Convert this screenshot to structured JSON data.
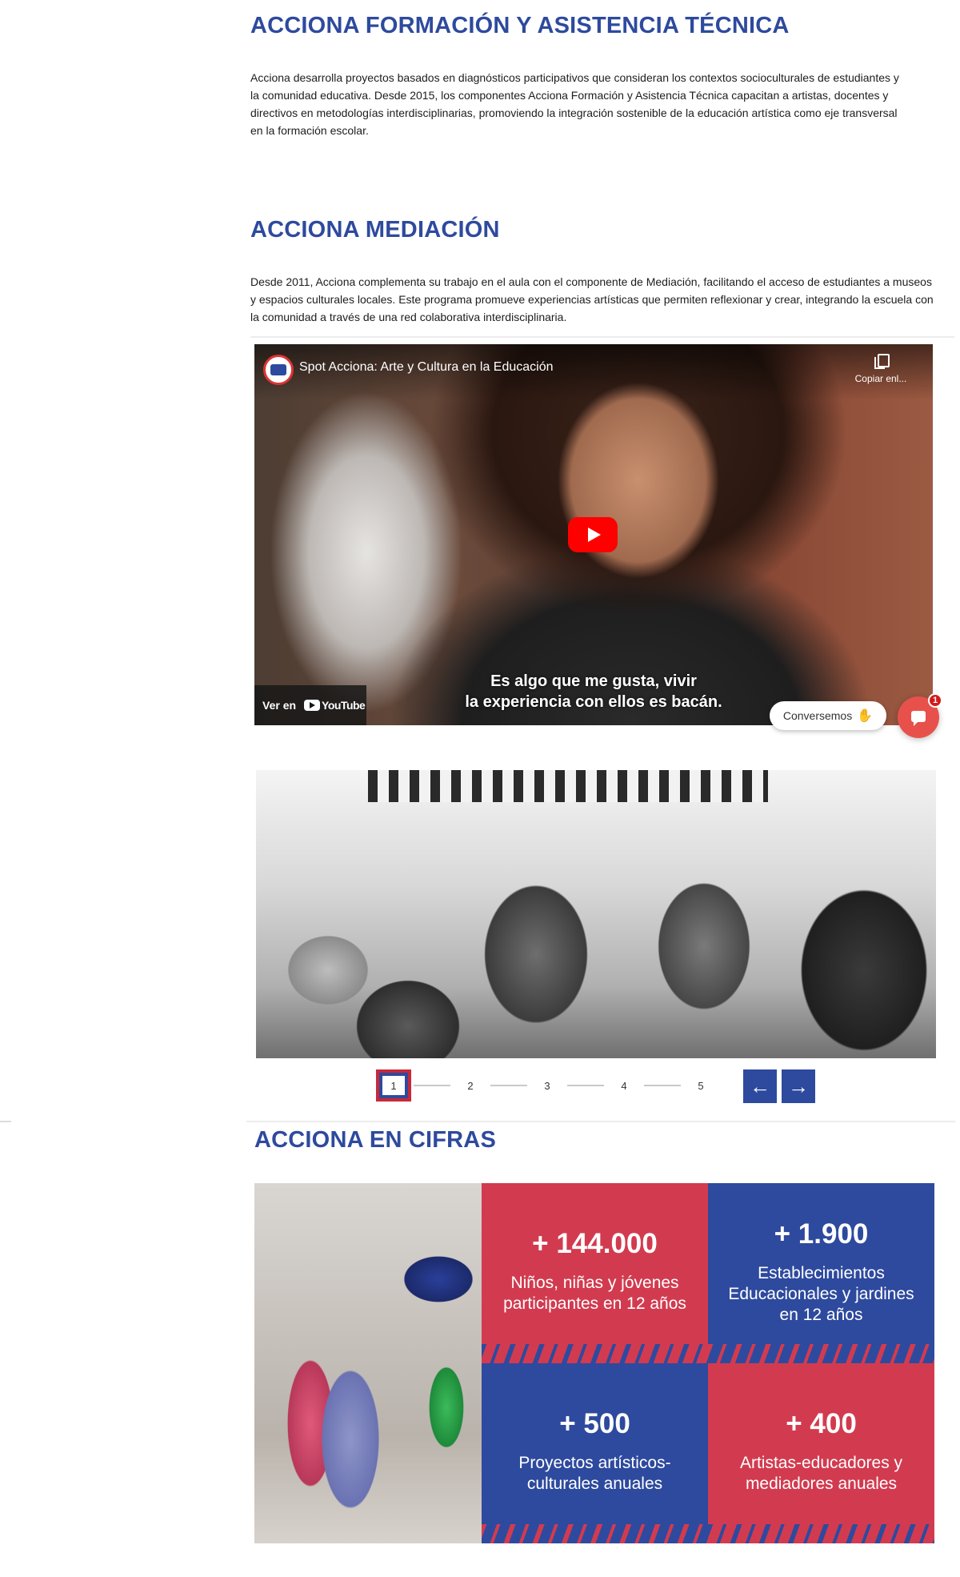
{
  "formacion": {
    "title": "ACCIONA FORMACIÓN Y ASISTENCIA TÉCNICA",
    "text": "Acciona desarrolla proyectos basados en diagnósticos participativos que consideran los contextos socioculturales de estudiantes y la comunidad educativa. Desde 2015, los componentes Acciona Formación y Asistencia Técnica capacitan a artistas, docentes y directivos en metodologías interdisciplinarias, promoviendo la integración sostenible de la educación artística como eje transversal en la formación escolar."
  },
  "mediacion": {
    "title": "ACCIONA MEDIACIÓN",
    "text": "Desde 2011, Acciona complementa su trabajo en el aula con el componente de Mediación, facilitando el acceso de estudiantes a museos y espacios culturales locales. Este programa promueve experiencias artísticas que permiten reflexionar y crear, integrando la escuela con la comunidad a través de una red colaborativa interdisciplinaria."
  },
  "video": {
    "title": "Spot Acciona: Arte y Cultura en la Educación",
    "copy_label": "Copiar enl...",
    "subtitle_line1": "Es algo que me gusta,  vivir",
    "subtitle_line2": "la experiencia con ellos es bacán.",
    "watch_on": "Ver en",
    "youtube": "YouTube"
  },
  "chat": {
    "label": "Conversemos",
    "badge": "1",
    "accent": "#e8514b"
  },
  "slider": {
    "pages": [
      "1",
      "2",
      "3",
      "4",
      "5"
    ],
    "active_page": 1,
    "prev_icon": "arrow-left-icon",
    "next_icon": "arrow-right-icon"
  },
  "cifras": {
    "title": "ACCIONA EN CIFRAS",
    "stats": [
      {
        "value": "+ 144.000",
        "label": "Niños, niñas y jóvenes participantes en 12 años",
        "color": "#d23b4f"
      },
      {
        "value": "+ 1.900",
        "label": "Establecimientos Educacionales y jardines en 12 años",
        "color": "#2e4a9e"
      },
      {
        "value": "+ 500",
        "label": "Proyectos artísticos-culturales anuales",
        "color": "#2e4a9e"
      },
      {
        "value": "+ 400",
        "label": "Artistas-educadores y mediadores anuales",
        "color": "#d23b4f"
      }
    ]
  },
  "colors": {
    "brand_blue": "#2e4a9e",
    "brand_red": "#d23b4f",
    "youtube_red": "#ff0000"
  }
}
